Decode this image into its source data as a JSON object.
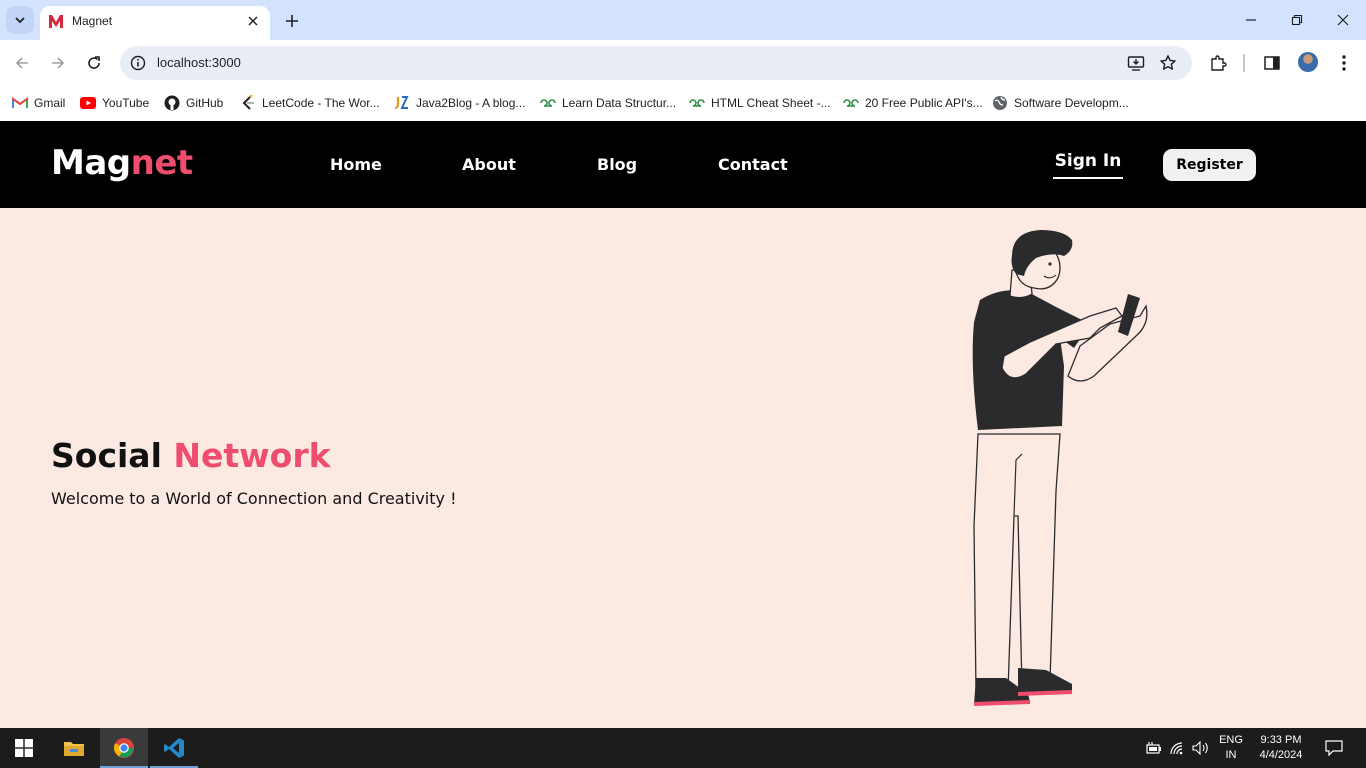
{
  "browser": {
    "tab": {
      "title": "Magnet",
      "favicon": "magnet-m-icon"
    },
    "url": "localhost:3000",
    "bookmarks": [
      {
        "label": "Gmail",
        "icon": "gmail-icon"
      },
      {
        "label": "YouTube",
        "icon": "youtube-icon"
      },
      {
        "label": "GitHub",
        "icon": "github-icon"
      },
      {
        "label": "LeetCode - The Wor...",
        "icon": "leetcode-icon"
      },
      {
        "label": "Java2Blog - A blog...",
        "icon": "java2blog-icon"
      },
      {
        "label": "Learn Data Structur...",
        "icon": "geeksforgeeks-icon"
      },
      {
        "label": "HTML Cheat Sheet -...",
        "icon": "geeksforgeeks-icon"
      },
      {
        "label": "20 Free Public API's...",
        "icon": "geeksforgeeks-icon"
      },
      {
        "label": "Software Developm...",
        "icon": "globe-icon"
      }
    ]
  },
  "site": {
    "logo": {
      "part1": "Mag",
      "part2": "net"
    },
    "nav": [
      "Home",
      "About",
      "Blog",
      "Contact"
    ],
    "signin": "Sign In",
    "register": "Register",
    "hero": {
      "title_part1": "Social",
      "title_part2": "Network",
      "subtitle": "Welcome to a World of Connection and Creativity !"
    }
  },
  "taskbar": {
    "lang_line1": "ENG",
    "lang_line2": "IN",
    "time": "9:33 PM",
    "date": "4/4/2024"
  },
  "colors": {
    "accent": "#ef4d6e",
    "hero_bg": "#fbe9e2",
    "nav_bg": "#000000",
    "tabstrip_bg": "#d3e3fd"
  }
}
